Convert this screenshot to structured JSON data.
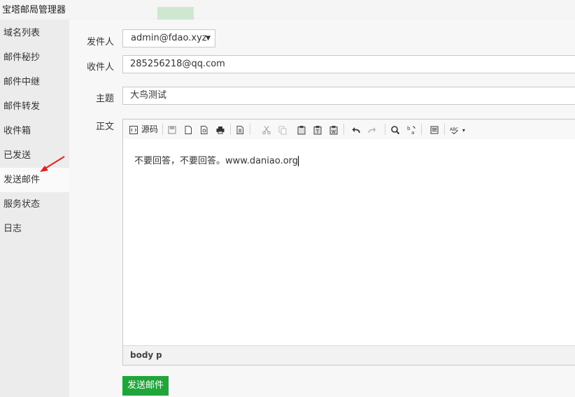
{
  "app": {
    "title": "宝塔邮局管理器"
  },
  "sidebar": {
    "items": [
      {
        "label": "域名列表"
      },
      {
        "label": "邮件秘抄"
      },
      {
        "label": "邮件中继"
      },
      {
        "label": "邮件转发"
      },
      {
        "label": "收件箱"
      },
      {
        "label": "已发送"
      },
      {
        "label": "发送邮件",
        "active": true
      },
      {
        "label": "服务状态"
      },
      {
        "label": "日志"
      }
    ]
  },
  "form": {
    "sender_label": "发件人",
    "sender_value": "admin@fdao.xyz",
    "recipient_label": "收件人",
    "recipient_value": "285256218@qq.com",
    "subject_label": "主题",
    "subject_value": "大鸟测试",
    "body_label": "正文"
  },
  "editor": {
    "source_label": "源码",
    "content": "不要回答，不要回答。www.daniao.org",
    "path": [
      "body",
      "p"
    ],
    "toolbar_icons": [
      "source-code-icon",
      "save-icon",
      "new-page-icon",
      "preview-icon",
      "print-icon",
      "templates-icon",
      "cut-icon",
      "copy-icon",
      "paste-icon",
      "paste-text-icon",
      "paste-word-icon",
      "undo-icon",
      "redo-icon",
      "find-icon",
      "replace-icon",
      "select-all-icon",
      "spellcheck-icon"
    ]
  },
  "actions": {
    "send_label": "发送邮件"
  },
  "colors": {
    "accent": "#20a53a",
    "annotation_arrow": "#e02020"
  }
}
